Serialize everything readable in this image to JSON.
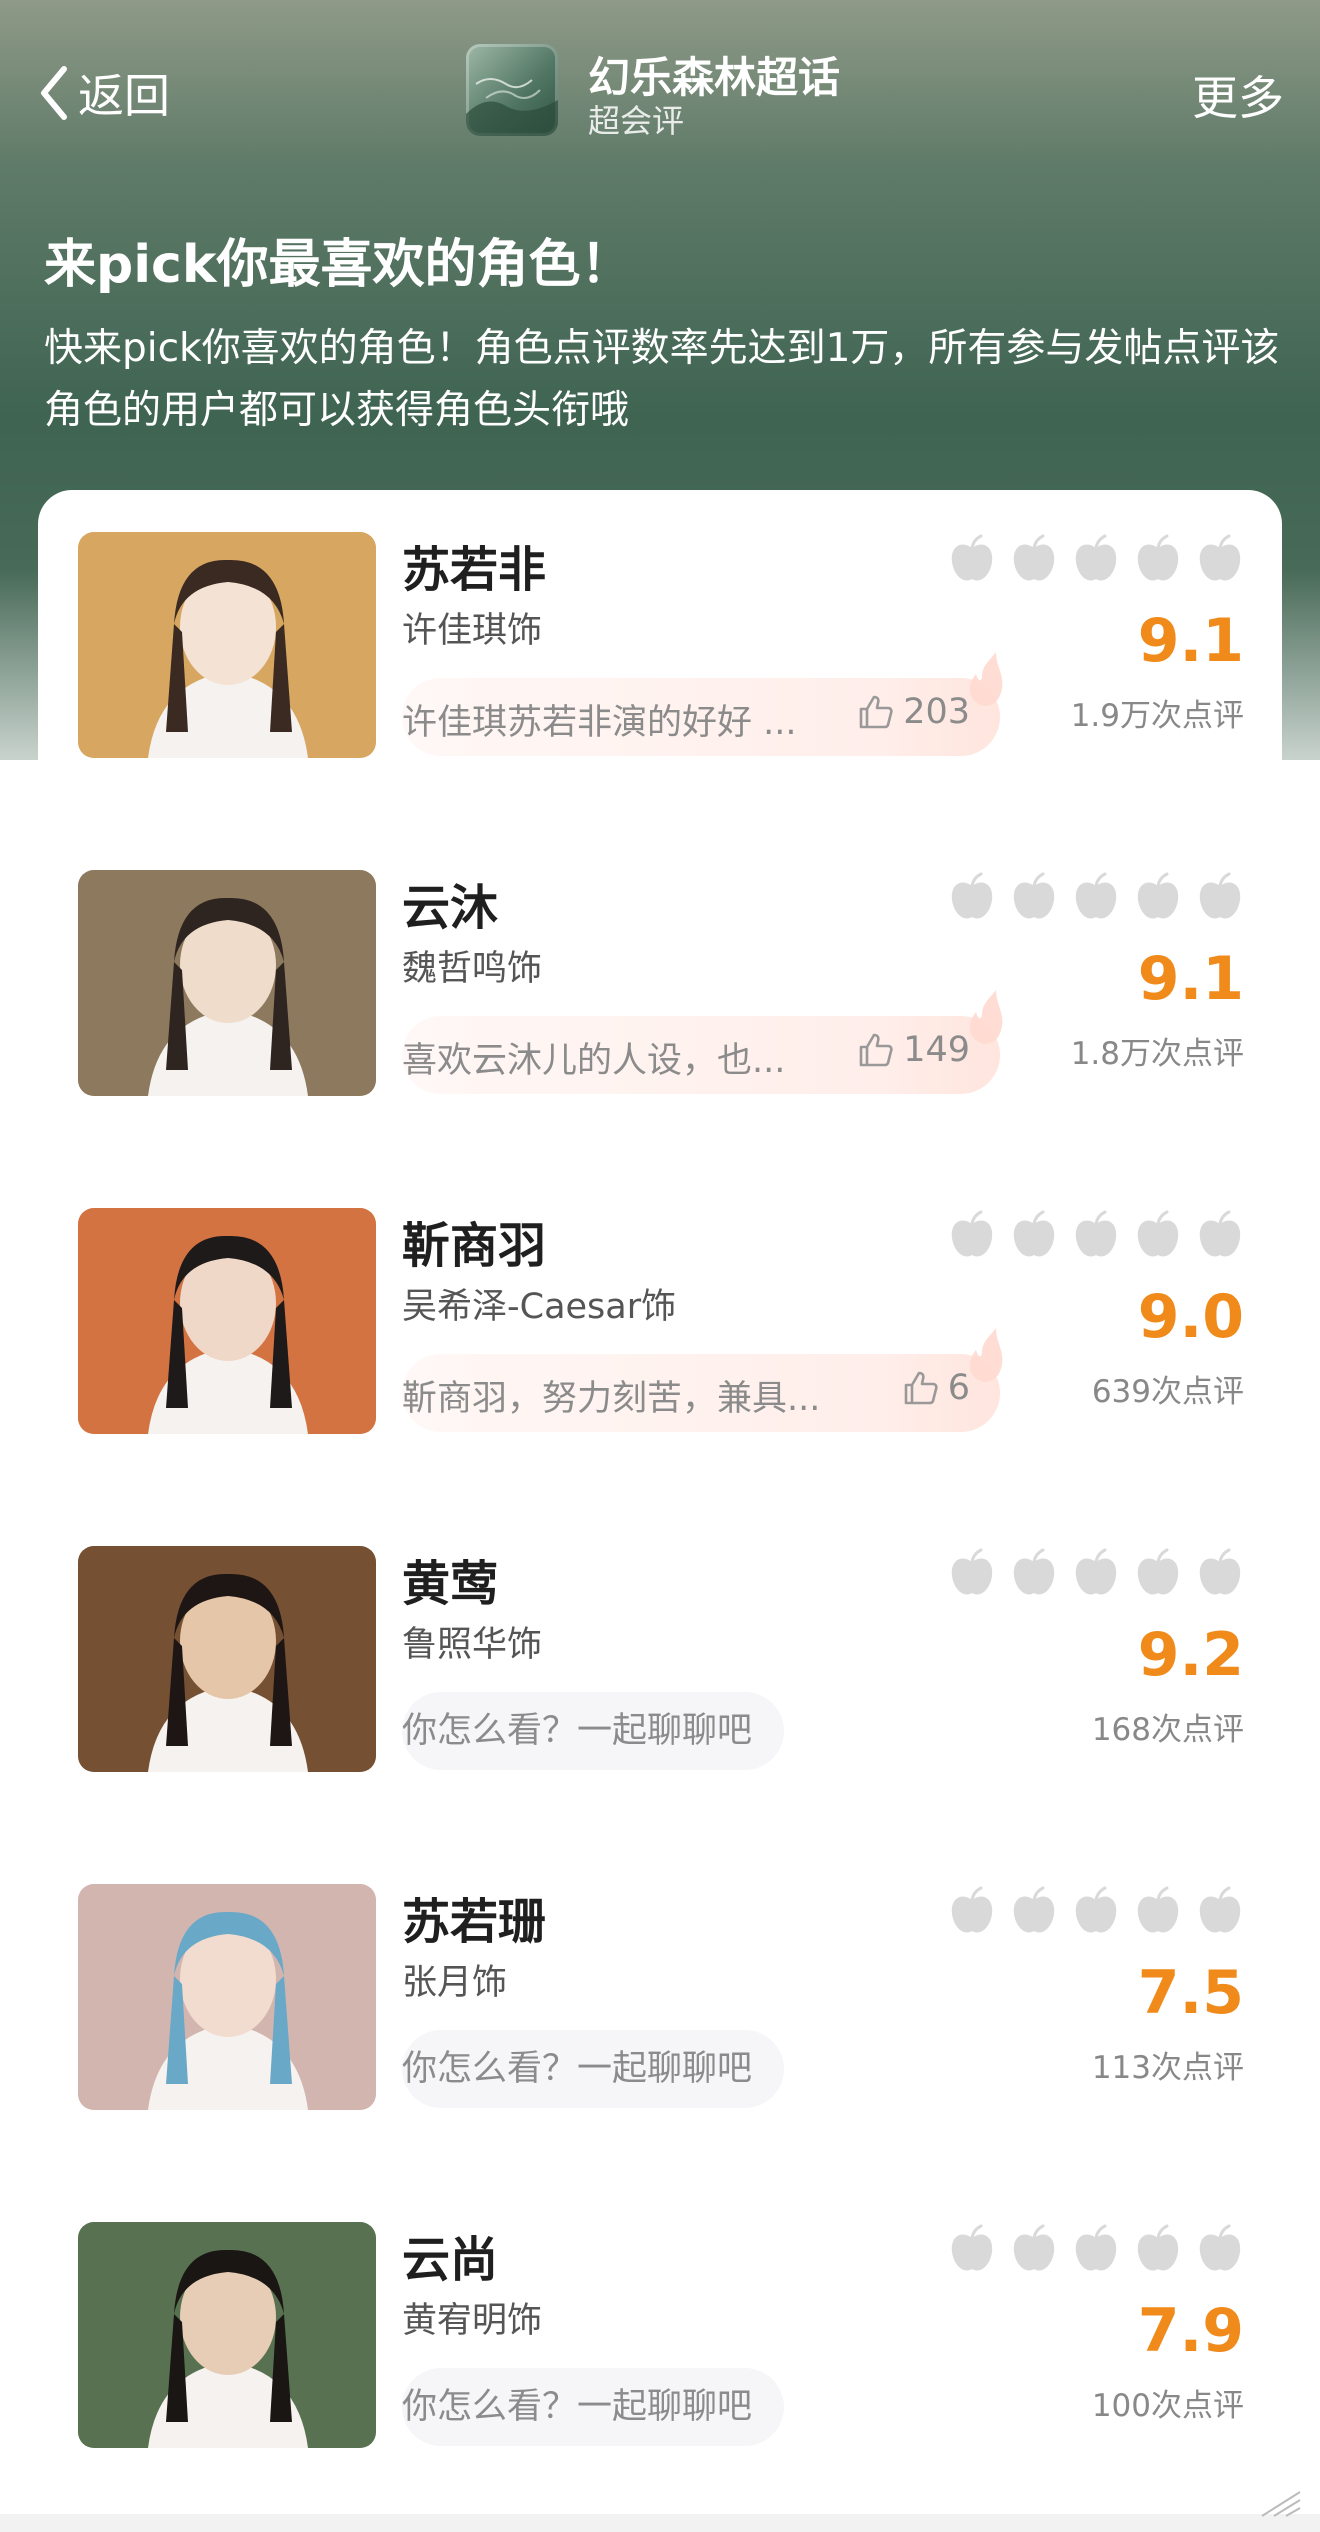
{
  "header": {
    "back_label": "返回",
    "forum_title": "幻乐森林超话",
    "forum_subtitle": "超会评",
    "more_label": "更多",
    "logo_text": "幻乐森林"
  },
  "intro": {
    "headline": "来pick你最喜欢的角色！",
    "description": "快来pick你喜欢的角色！角色点评数率先达到1万，所有参与发帖点评该角色的用户都可以获得角色头衔哦"
  },
  "colors": {
    "score": "#f08a1a",
    "apple_rating": "#d9d9d9"
  },
  "characters": [
    {
      "name": "苏若非",
      "actor": "许佳琪饰",
      "score": "9.1",
      "reviews": "1.9万次点评",
      "comment": "许佳琪苏若非演的好好 ...",
      "likes": "203",
      "has_comment": true
    },
    {
      "name": "云沐",
      "actor": "魏哲鸣饰",
      "score": "9.1",
      "reviews": "1.8万次点评",
      "comment": "喜欢云沐儿的人设，也...",
      "likes": "149",
      "has_comment": true
    },
    {
      "name": "靳商羽",
      "actor": "吴希泽-Caesar饰",
      "score": "9.0",
      "reviews": "639次点评",
      "comment": "靳商羽，努力刻苦，兼具...",
      "likes": "6",
      "has_comment": true
    },
    {
      "name": "黄莺",
      "actor": "鲁照华饰",
      "score": "9.2",
      "reviews": "168次点评",
      "comment": "你怎么看？一起聊聊吧",
      "has_comment": false
    },
    {
      "name": "苏若珊",
      "actor": "张月饰",
      "score": "7.5",
      "reviews": "113次点评",
      "comment": "你怎么看？一起聊聊吧",
      "has_comment": false
    },
    {
      "name": "云尚",
      "actor": "黄宥明饰",
      "score": "7.9",
      "reviews": "100次点评",
      "comment": "你怎么看？一起聊聊吧",
      "has_comment": false
    }
  ]
}
